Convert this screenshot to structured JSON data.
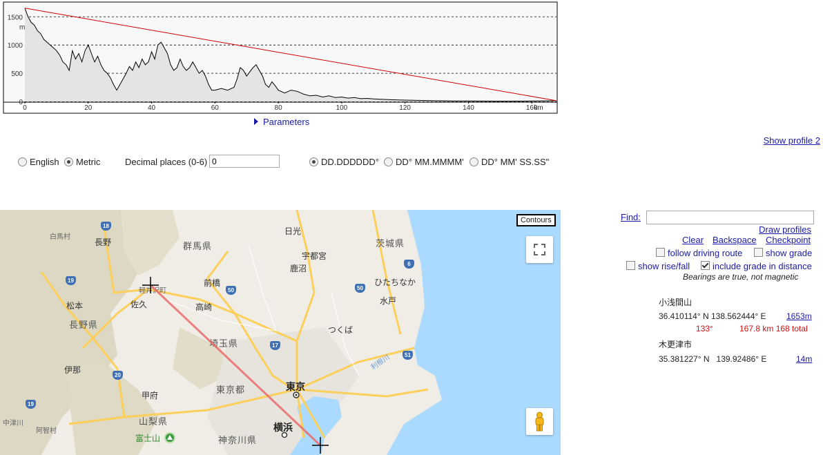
{
  "profile": {
    "y_ticks": [
      "1500",
      "1000",
      "500",
      "0"
    ],
    "y_unit": "m",
    "x_ticks": [
      "0",
      "20",
      "40",
      "60",
      "80",
      "100",
      "120",
      "140",
      "160"
    ],
    "x_unit": "km",
    "x_range_km": [
      0,
      167.8
    ],
    "y_range_m": [
      0,
      1653
    ],
    "elevation_series_km_m": [
      [
        0,
        1653
      ],
      [
        1,
        1500
      ],
      [
        2,
        1400
      ],
      [
        3,
        1350
      ],
      [
        4,
        1250
      ],
      [
        5,
        1200
      ],
      [
        6,
        1100
      ],
      [
        7,
        1050
      ],
      [
        8,
        1000
      ],
      [
        9,
        950
      ],
      [
        10,
        900
      ],
      [
        11,
        820
      ],
      [
        12,
        700
      ],
      [
        13,
        650
      ],
      [
        14,
        550
      ],
      [
        15,
        900
      ],
      [
        16,
        750
      ],
      [
        17,
        850
      ],
      [
        18,
        700
      ],
      [
        19,
        900
      ],
      [
        20,
        1000
      ],
      [
        21,
        850
      ],
      [
        22,
        700
      ],
      [
        23,
        800
      ],
      [
        24,
        650
      ],
      [
        25,
        550
      ],
      [
        26,
        500
      ],
      [
        27,
        420
      ],
      [
        28,
        300
      ],
      [
        29,
        200
      ],
      [
        30,
        300
      ],
      [
        31,
        400
      ],
      [
        32,
        500
      ],
      [
        33,
        620
      ],
      [
        34,
        550
      ],
      [
        35,
        700
      ],
      [
        36,
        600
      ],
      [
        37,
        750
      ],
      [
        38,
        650
      ],
      [
        39,
        700
      ],
      [
        40,
        880
      ],
      [
        41,
        750
      ],
      [
        42,
        1000
      ],
      [
        43,
        1050
      ],
      [
        44,
        950
      ],
      [
        45,
        850
      ],
      [
        46,
        650
      ],
      [
        47,
        550
      ],
      [
        48,
        600
      ],
      [
        49,
        750
      ],
      [
        50,
        620
      ],
      [
        51,
        550
      ],
      [
        52,
        600
      ],
      [
        53,
        700
      ],
      [
        54,
        600
      ],
      [
        55,
        500
      ],
      [
        56,
        550
      ],
      [
        57,
        450
      ],
      [
        58,
        300
      ],
      [
        59,
        200
      ],
      [
        60,
        200
      ],
      [
        62,
        230
      ],
      [
        64,
        200
      ],
      [
        66,
        250
      ],
      [
        67,
        400
      ],
      [
        68,
        600
      ],
      [
        69,
        550
      ],
      [
        70,
        450
      ],
      [
        72,
        600
      ],
      [
        73,
        650
      ],
      [
        74,
        550
      ],
      [
        75,
        450
      ],
      [
        76,
        300
      ],
      [
        77,
        250
      ],
      [
        78,
        350
      ],
      [
        79,
        280
      ],
      [
        80,
        200
      ],
      [
        82,
        150
      ],
      [
        84,
        200
      ],
      [
        86,
        180
      ],
      [
        88,
        130
      ],
      [
        90,
        100
      ],
      [
        92,
        110
      ],
      [
        94,
        80
      ],
      [
        96,
        100
      ],
      [
        98,
        70
      ],
      [
        100,
        80
      ],
      [
        102,
        60
      ],
      [
        104,
        70
      ],
      [
        106,
        50
      ],
      [
        108,
        55
      ],
      [
        110,
        45
      ],
      [
        112,
        40
      ],
      [
        114,
        35
      ],
      [
        116,
        30
      ],
      [
        120,
        25
      ],
      [
        124,
        20
      ],
      [
        128,
        15
      ],
      [
        132,
        12
      ],
      [
        136,
        10
      ],
      [
        140,
        8
      ],
      [
        150,
        6
      ],
      [
        160,
        8
      ],
      [
        167.8,
        14
      ]
    ],
    "straight_line": {
      "start_m": 1653,
      "end_m": 14
    },
    "colors": {
      "profile_line": "#000000",
      "profile_fill": "#e4e4e4",
      "chord_line": "#cc0000",
      "background": "#f8f8f8"
    }
  },
  "parameters_label": "Parameters",
  "show_profile_2": "Show profile 2",
  "settings": {
    "units": [
      {
        "label": "English",
        "selected": false
      },
      {
        "label": "Metric",
        "selected": true
      }
    ],
    "decimal_label": "Decimal places (0-6)",
    "decimal_value": "0",
    "formats": [
      {
        "label": "DD.DDDDDD°",
        "selected": true
      },
      {
        "label": "DD° MM.MMMM'",
        "selected": false
      },
      {
        "label": "DD° MM' SS.SS\"",
        "selected": false
      }
    ]
  },
  "map": {
    "contours_label": "Contours",
    "prefectures": [
      "群馬県",
      "茨城県",
      "長野県",
      "埼玉県",
      "東京都",
      "山梨県",
      "神奈川県"
    ],
    "big_cities": [
      "東京",
      "横浜"
    ],
    "cities": [
      "長野",
      "日光",
      "宇都宮",
      "鹿沼",
      "前橋",
      "高崎",
      "ひたちなか",
      "水戸",
      "佐久",
      "軽井沢町",
      "松本",
      "つくば",
      "伊那",
      "甲府",
      "富士山",
      "中津川",
      "阿智村",
      "白馬村"
    ],
    "rivers": [
      "利根川"
    ],
    "routes": [
      "18",
      "19",
      "50",
      "6",
      "50",
      "17",
      "51",
      "20",
      "19"
    ],
    "colors": {
      "land": "#f0ede6",
      "water": "#aadaff",
      "mountain": "#ddd8c4",
      "highway": "#fbcf59",
      "route_line": "#ea6b6b",
      "urban": "#e6e3dc",
      "park": "#b7dfa5"
    }
  },
  "panel": {
    "find_label": "Find:",
    "find_value": "",
    "draw_profiles": "Draw profiles",
    "clear": "Clear",
    "backspace": "Backspace",
    "checkpoint": "Checkpoint",
    "follow_driving_route": {
      "label": "follow driving route",
      "checked": false
    },
    "show_grade": {
      "label": "show grade",
      "checked": false
    },
    "show_rise_fall": {
      "label": "show rise/fall",
      "checked": false
    },
    "include_grade": {
      "label": "include grade in distance",
      "checked": true
    },
    "bearings_note": "Bearings are true, not magnetic",
    "point1": {
      "name": "小浅間山",
      "coords": "36.410114° N 138.562444° E",
      "elevation": "1653m"
    },
    "segment": {
      "bearing": "133°",
      "distance": "167.8 km 168 total"
    },
    "point2": {
      "name": "木更津市",
      "coords": "35.381227° N   139.92486° E",
      "elevation": "14m"
    }
  }
}
